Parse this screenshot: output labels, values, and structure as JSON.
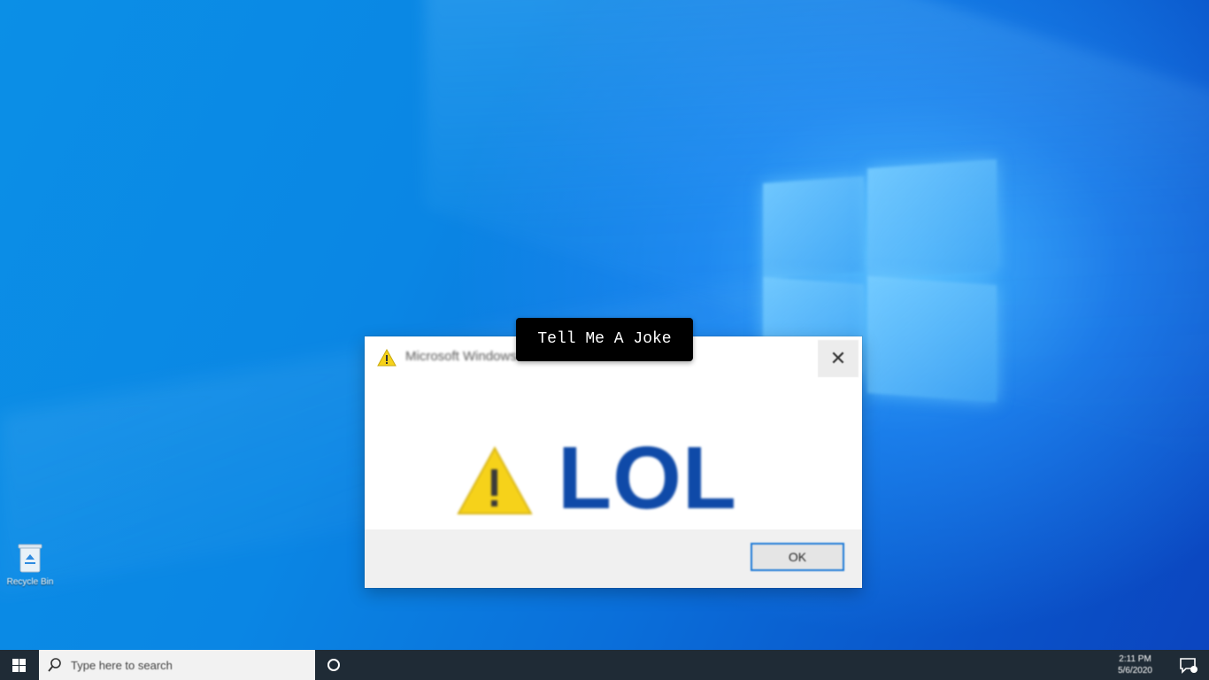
{
  "desktop": {
    "recycle_bin_label": "Recycle Bin"
  },
  "dialog": {
    "title": "Microsoft Windows",
    "message": "LOL",
    "ok_label": "OK",
    "close_glyph": "✕",
    "title_icon": "warning-icon",
    "message_icon": "warning-icon"
  },
  "tooltip": {
    "text": "Tell Me A Joke"
  },
  "taskbar": {
    "search_placeholder": "Type here to search",
    "time": "2:11 PM",
    "date": "5/6/2020"
  },
  "colors": {
    "desktop_blue": "#0a86e4",
    "lol_text": "#0f4aa8",
    "warning_yellow": "#f6d21a",
    "taskbar": "#1f2b36",
    "ok_border": "#1e7ad6"
  }
}
